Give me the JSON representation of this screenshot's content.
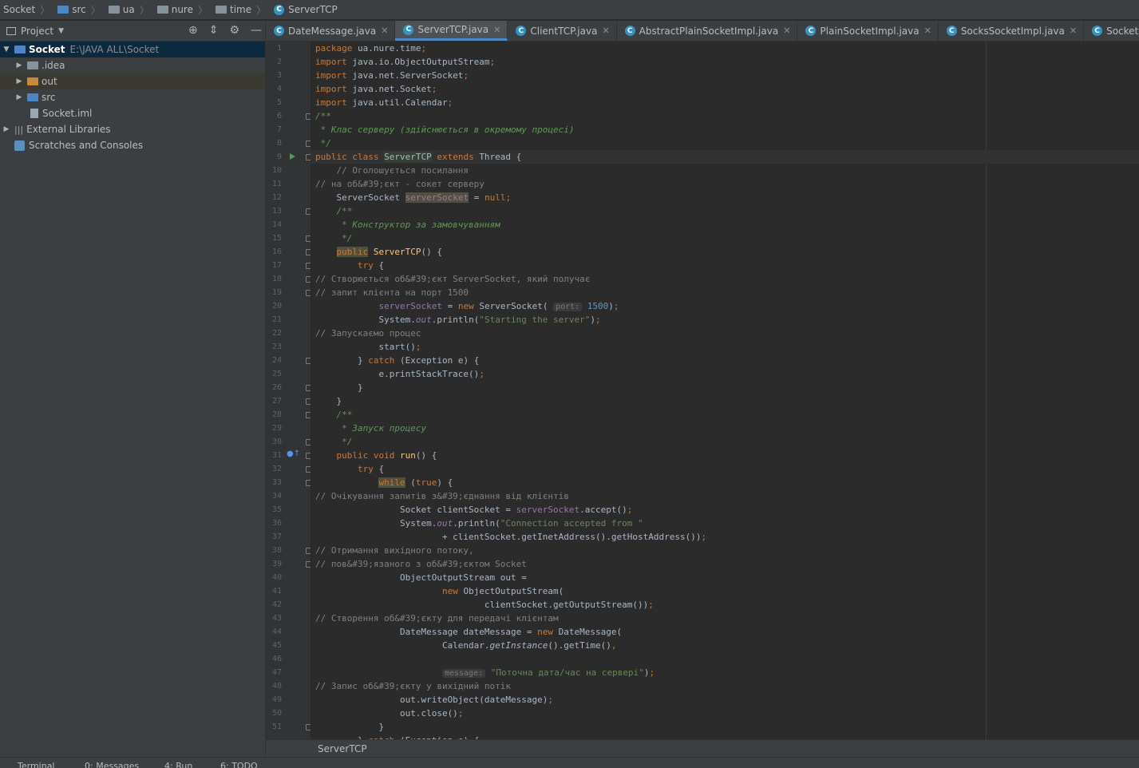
{
  "breadcrumbs": [
    "Socket",
    "src",
    "ua",
    "nure",
    "time",
    "ServerTCP"
  ],
  "project_panel": {
    "title": "Project",
    "root": {
      "name": "Socket",
      "path": "E:\\JAVA ALL\\Socket"
    },
    "items": [
      {
        "label": ".idea"
      },
      {
        "label": "out"
      },
      {
        "label": "src"
      },
      {
        "label": "Socket.iml"
      },
      {
        "label": "External Libraries"
      },
      {
        "label": "Scratches and Consoles"
      }
    ]
  },
  "tabs": [
    {
      "label": "DateMessage.java",
      "active": false
    },
    {
      "label": "ServerTCP.java",
      "active": true
    },
    {
      "label": "ClientTCP.java",
      "active": false
    },
    {
      "label": "AbstractPlainSocketImpl.java",
      "active": false
    },
    {
      "label": "PlainSocketImpl.java",
      "active": false
    },
    {
      "label": "SocksSocketImpl.java",
      "active": false
    },
    {
      "label": "Socket.java",
      "active": false
    }
  ],
  "editor": {
    "line_numbers": [
      "1",
      "2",
      "3",
      "4",
      "5",
      "6",
      "7",
      "8",
      "9",
      "10",
      "11",
      "12",
      "13",
      "14",
      "15",
      "16",
      "17",
      "18",
      "19",
      "20",
      "21",
      "22",
      "23",
      "24",
      "25",
      "26",
      "27",
      "28",
      "29",
      "30",
      "31",
      "32",
      "33",
      "34",
      "35",
      "36",
      "37",
      "38",
      "39",
      "40",
      "41",
      "42",
      "43",
      "44",
      "45",
      "46",
      "47",
      "48",
      "49",
      "50",
      "51"
    ],
    "hint_port": "port:",
    "hint_message": "message:"
  },
  "bottom_breadcrumb": "ServerTCP",
  "tool_windows": [
    "Terminal",
    "0: Messages",
    "4: Run",
    "6: TODO"
  ],
  "colors": {
    "accent": "#4a88c7",
    "keyword": "#cc7832",
    "string": "#6a8759",
    "comment": "#808080",
    "doc": "#629755"
  }
}
